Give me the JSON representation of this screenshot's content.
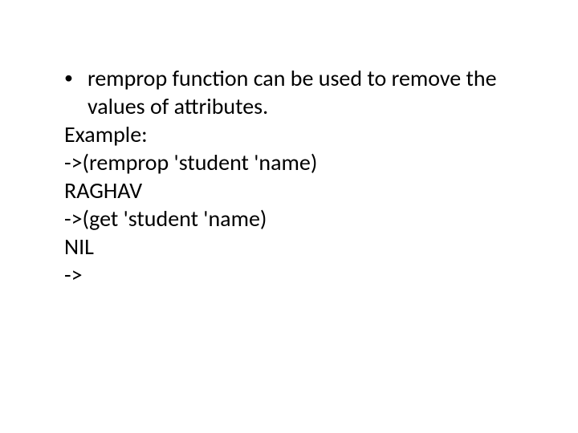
{
  "slide": {
    "bullet_marker": "•",
    "bullet": "remprop function can be used to remove the values of attributes.",
    "lines": {
      "l1": "Example:",
      "l2": "->(remprop 'student 'name)",
      "l3": "RAGHAV",
      "l4": "->(get 'student 'name)",
      "l5": "NIL",
      "l6": "->"
    }
  }
}
